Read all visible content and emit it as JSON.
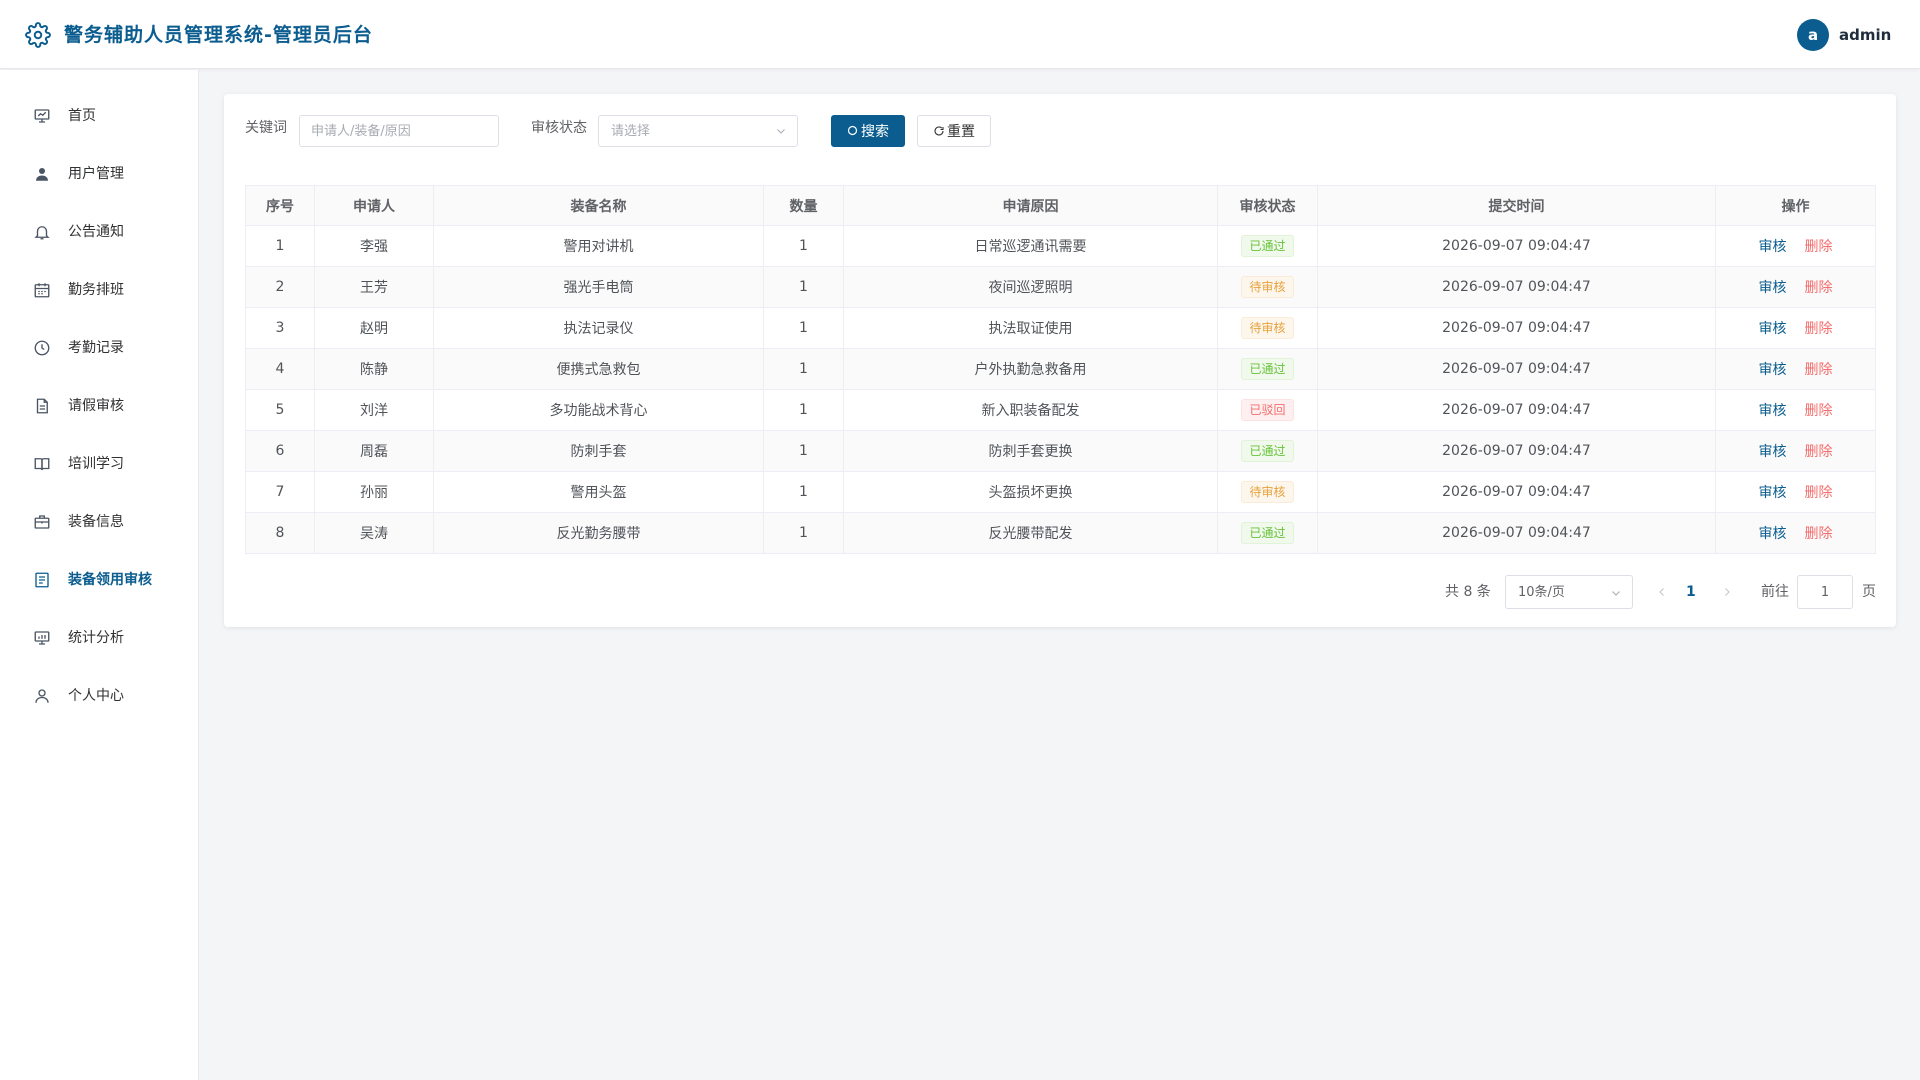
{
  "header": {
    "title": "警务辅助人员管理系统-管理员后台",
    "logo_icon": "gear-icon",
    "avatar_letter": "a",
    "username": "admin",
    "brand_color": "#0b5d8f"
  },
  "sidebar": {
    "items": [
      {
        "label": "首页",
        "icon": "presentation-icon",
        "active": false
      },
      {
        "label": "用户管理",
        "icon": "user-icon",
        "active": false
      },
      {
        "label": "公告通知",
        "icon": "bell-icon",
        "active": false
      },
      {
        "label": "勤务排班",
        "icon": "calendar-icon",
        "active": false
      },
      {
        "label": "考勤记录",
        "icon": "clock-icon",
        "active": false
      },
      {
        "label": "请假审核",
        "icon": "document-icon",
        "active": false
      },
      {
        "label": "培训学习",
        "icon": "book-icon",
        "active": false
      },
      {
        "label": "装备信息",
        "icon": "briefcase-icon",
        "active": false
      },
      {
        "label": "装备领用审核",
        "icon": "list-document-icon",
        "active": true
      },
      {
        "label": "统计分析",
        "icon": "chart-board-icon",
        "active": false
      },
      {
        "label": "个人中心",
        "icon": "person-icon",
        "active": false
      }
    ]
  },
  "filters": {
    "keyword_label": "关键词",
    "keyword_value": "",
    "keyword_placeholder": "申请人/装备/原因",
    "status_label": "审核状态",
    "status_placeholder": "请选择",
    "search_label": "搜索",
    "reset_label": "重置"
  },
  "table": {
    "columns": [
      "序号",
      "申请人",
      "装备名称",
      "数量",
      "申请原因",
      "审核状态",
      "提交时间",
      "操作"
    ],
    "rows": [
      {
        "no": "1",
        "applicant": "李强",
        "equipment": "警用对讲机",
        "qty": "1",
        "reason": "日常巡逻通讯需要",
        "status": "已通过",
        "status_color": "green",
        "time": "2026-09-07 09:04:47"
      },
      {
        "no": "2",
        "applicant": "王芳",
        "equipment": "强光手电筒",
        "qty": "1",
        "reason": "夜间巡逻照明",
        "status": "待审核",
        "status_color": "orange",
        "time": "2026-09-07 09:04:47"
      },
      {
        "no": "3",
        "applicant": "赵明",
        "equipment": "执法记录仪",
        "qty": "1",
        "reason": "执法取证使用",
        "status": "待审核",
        "status_color": "orange",
        "time": "2026-09-07 09:04:47"
      },
      {
        "no": "4",
        "applicant": "陈静",
        "equipment": "便携式急救包",
        "qty": "1",
        "reason": "户外执勤急救备用",
        "status": "已通过",
        "status_color": "green",
        "time": "2026-09-07 09:04:47"
      },
      {
        "no": "5",
        "applicant": "刘洋",
        "equipment": "多功能战术背心",
        "qty": "1",
        "reason": "新入职装备配发",
        "status": "已驳回",
        "status_color": "red",
        "time": "2026-09-07 09:04:47"
      },
      {
        "no": "6",
        "applicant": "周磊",
        "equipment": "防刺手套",
        "qty": "1",
        "reason": "防刺手套更换",
        "status": "已通过",
        "status_color": "green",
        "time": "2026-09-07 09:04:47"
      },
      {
        "no": "7",
        "applicant": "孙丽",
        "equipment": "警用头盔",
        "qty": "1",
        "reason": "头盔损坏更换",
        "status": "待审核",
        "status_color": "orange",
        "time": "2026-09-07 09:04:47"
      },
      {
        "no": "8",
        "applicant": "吴涛",
        "equipment": "反光勤务腰带",
        "qty": "1",
        "reason": "反光腰带配发",
        "status": "已通过",
        "status_color": "green",
        "time": "2026-09-07 09:04:47"
      }
    ],
    "actions": {
      "audit": "审核",
      "delete": "删除"
    }
  },
  "pagination": {
    "total_text": "共 8 条",
    "page_size": "10条/页",
    "current_page": "1",
    "goto_label": "前往",
    "goto_value": "1",
    "page_suffix": "页"
  }
}
